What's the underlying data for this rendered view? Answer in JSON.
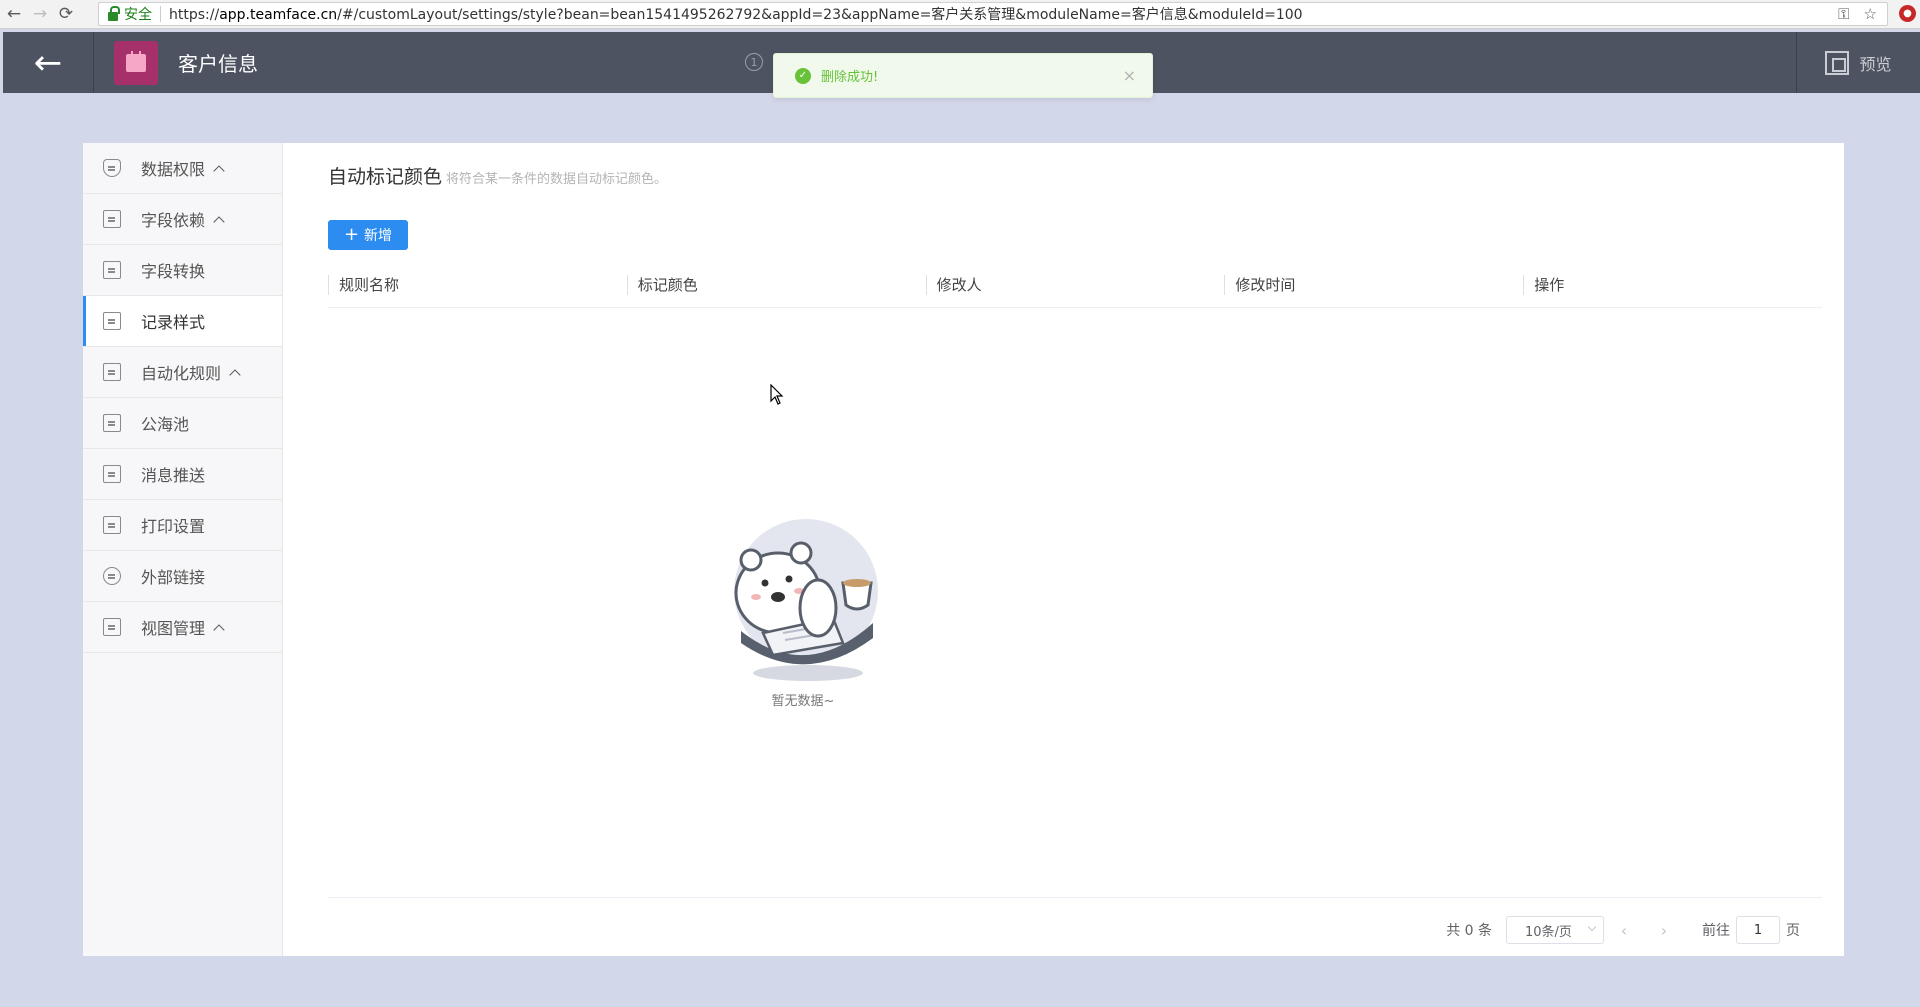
{
  "browser": {
    "back_label": "←",
    "forward_label": "→",
    "reload_label": "⟳",
    "secure_label": "安全",
    "url_prefix": "https://",
    "url_host": "app.teamface.cn",
    "url_rest": "/#/customLayout/settings/style?bean=bean1541495262792&appId=23&appName=客户关系管理&moduleName=客户信息&moduleId=100"
  },
  "header": {
    "module_title": "客户信息",
    "info_label": "1",
    "preview_label": "预览"
  },
  "toast": {
    "message": "删除成功!",
    "close_label": "×"
  },
  "sidebar": {
    "items": [
      {
        "label": "数据权限",
        "icon": "shield-icon",
        "chevron": true
      },
      {
        "label": "字段依赖",
        "icon": "field-dependency-icon",
        "chevron": true
      },
      {
        "label": "字段转换",
        "icon": "field-convert-icon",
        "chevron": false
      },
      {
        "label": "记录样式",
        "icon": "record-style-icon",
        "chevron": false,
        "active": true
      },
      {
        "label": "自动化规则",
        "icon": "automation-icon",
        "chevron": true
      },
      {
        "label": "公海池",
        "icon": "pool-icon",
        "chevron": false
      },
      {
        "label": "消息推送",
        "icon": "message-push-icon",
        "chevron": false
      },
      {
        "label": "打印设置",
        "icon": "printer-icon",
        "chevron": false
      },
      {
        "label": "外部链接",
        "icon": "link-icon",
        "chevron": false
      },
      {
        "label": "视图管理",
        "icon": "view-manage-icon",
        "chevron": true
      }
    ]
  },
  "main": {
    "title": "自动标记颜色",
    "description": "将符合某一条件的数据自动标记颜色。",
    "add_button_label": "新增",
    "columns": [
      "规则名称",
      "标记颜色",
      "修改人",
      "修改时间",
      "操作"
    ],
    "empty_text": "暂无数据~"
  },
  "pagination": {
    "total_label": "共 0 条",
    "page_size": "10条/页",
    "goto_label": "前往",
    "current_page": "1",
    "page_suffix": "页"
  },
  "colors": {
    "header_bg": "#4d5360",
    "page_bg": "#d3d7ea",
    "primary": "#2d8cf0",
    "success": "#67c23a",
    "module_icon_bg": "#a6306a"
  }
}
